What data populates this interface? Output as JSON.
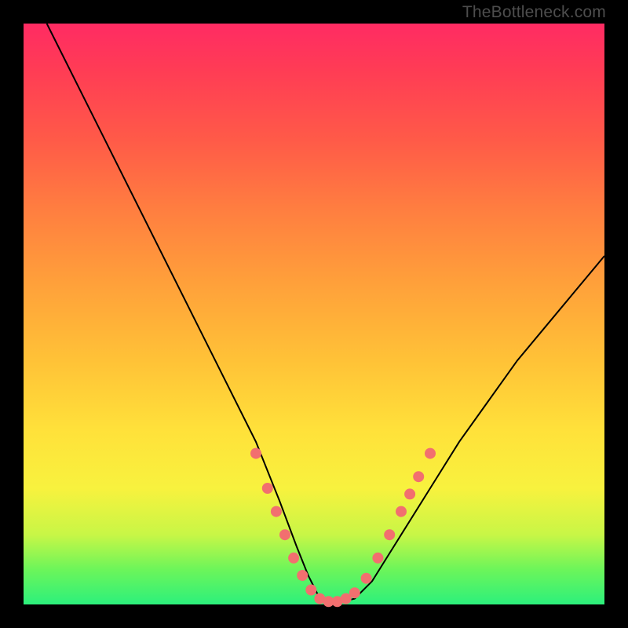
{
  "watermark": "TheBottleneck.com",
  "colors": {
    "frame": "#000000",
    "curve": "#000000",
    "marker": "#f26f6f",
    "gradient_top": "#ff2b63",
    "gradient_mid": "#ffe13a",
    "gradient_bottom": "#2cf07c"
  },
  "chart_data": {
    "type": "line",
    "title": "",
    "xlabel": "",
    "ylabel": "",
    "xlim": [
      0,
      100
    ],
    "ylim": [
      0,
      100
    ],
    "series": [
      {
        "name": "bottleneck-curve",
        "x": [
          4,
          10,
          15,
          20,
          25,
          30,
          35,
          40,
          44,
          47,
          49,
          51,
          53,
          55,
          57,
          60,
          65,
          70,
          75,
          80,
          85,
          90,
          95,
          100
        ],
        "y": [
          100,
          88,
          78,
          68,
          58,
          48,
          38,
          28,
          18,
          10,
          5,
          1,
          0.5,
          0.5,
          1,
          4,
          12,
          20,
          28,
          35,
          42,
          48,
          54,
          60
        ]
      }
    ],
    "markers": {
      "name": "highlighted-points",
      "points": [
        {
          "x": 40,
          "y": 26
        },
        {
          "x": 42,
          "y": 20
        },
        {
          "x": 43.5,
          "y": 16
        },
        {
          "x": 45,
          "y": 12
        },
        {
          "x": 46.5,
          "y": 8
        },
        {
          "x": 48,
          "y": 5
        },
        {
          "x": 49.5,
          "y": 2.5
        },
        {
          "x": 51,
          "y": 1
        },
        {
          "x": 52.5,
          "y": 0.5
        },
        {
          "x": 54,
          "y": 0.5
        },
        {
          "x": 55.5,
          "y": 1
        },
        {
          "x": 57,
          "y": 2
        },
        {
          "x": 59,
          "y": 4.5
        },
        {
          "x": 61,
          "y": 8
        },
        {
          "x": 63,
          "y": 12
        },
        {
          "x": 65,
          "y": 16
        },
        {
          "x": 66.5,
          "y": 19
        },
        {
          "x": 68,
          "y": 22
        },
        {
          "x": 70,
          "y": 26
        }
      ]
    }
  }
}
